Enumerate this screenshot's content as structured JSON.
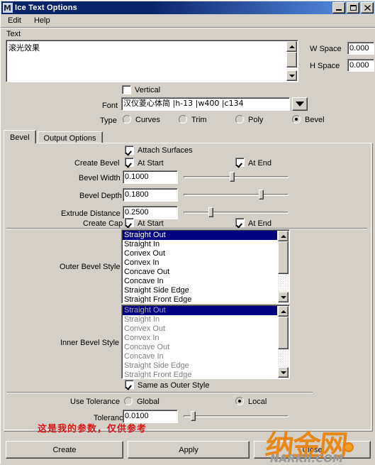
{
  "window": {
    "title": "Ice Text Options",
    "icon": "app-icon",
    "buttons": {
      "minimize": "_",
      "maximize": "❐",
      "close": "✕"
    }
  },
  "menu": {
    "items": [
      "Edit",
      "Help"
    ]
  },
  "text_group": {
    "label": "Text",
    "value": "滚光效果",
    "vertical": {
      "label": "Vertical",
      "checked": false
    },
    "w_space": {
      "label": "W Space",
      "value": "0.000"
    },
    "h_space": {
      "label": "H Space",
      "value": "0.000"
    },
    "font": {
      "label": "Font",
      "value": "汉仪菱心体简 |h-13 |w400 |c134"
    },
    "type": {
      "label": "Type",
      "options": [
        "Curves",
        "Trim",
        "Poly",
        "Bevel"
      ],
      "selected": "Bevel"
    }
  },
  "tabs": {
    "items": [
      "Bevel",
      "Output Options"
    ],
    "active": "Bevel"
  },
  "bevel": {
    "attach_surfaces": {
      "label": "Attach Surfaces",
      "checked": true
    },
    "create_bevel": {
      "label": "Create Bevel",
      "at_start": {
        "label": "At Start",
        "checked": true
      },
      "at_end": {
        "label": "At End",
        "checked": true
      }
    },
    "bevel_width": {
      "label": "Bevel Width",
      "value": "0.1000",
      "slider_pct": 46
    },
    "bevel_depth": {
      "label": "Bevel Depth",
      "value": "0.1800",
      "slider_pct": 75
    },
    "extrude_distance": {
      "label": "Extrude Distance",
      "value": "0.2500",
      "slider_pct": 25
    },
    "create_cap": {
      "label": "Create Cap",
      "at_start": {
        "label": "At Start",
        "checked": true
      },
      "at_end": {
        "label": "At End",
        "checked": true
      }
    },
    "outer_bevel_style": {
      "label": "Outer Bevel Style",
      "options": [
        "Straight Out",
        "Straight In",
        "Convex Out",
        "Convex In",
        "Concave Out",
        "Concave In",
        "Straight Side Edge",
        "Straight Front Edge"
      ],
      "selected": "Straight Out",
      "enabled": true
    },
    "inner_bevel_style": {
      "label": "Inner Bevel Style",
      "options": [
        "Straight Out",
        "Straight In",
        "Convex Out",
        "Convex In",
        "Concave Out",
        "Concave In",
        "Straight Side Edge",
        "Straight Front Edge"
      ],
      "selected": "Straight Out",
      "enabled": false
    },
    "same_as_outer": {
      "label": "Same as Outer Style",
      "checked": true
    },
    "use_tolerance": {
      "label": "Use Tolerance",
      "options": [
        "Global",
        "Local"
      ],
      "selected": "Local"
    },
    "tolerance": {
      "label": "Tolerance",
      "value": "0.0100",
      "slider_pct": 7
    }
  },
  "annotation": {
    "text": "这是我的参数，仅供参考",
    "color": "#d81616"
  },
  "footer": {
    "buttons": [
      "Create",
      "Apply",
      "Close"
    ]
  },
  "watermark": {
    "cn": "纳金网",
    "en": "NARKII.COM",
    "color": "#e8820c"
  }
}
